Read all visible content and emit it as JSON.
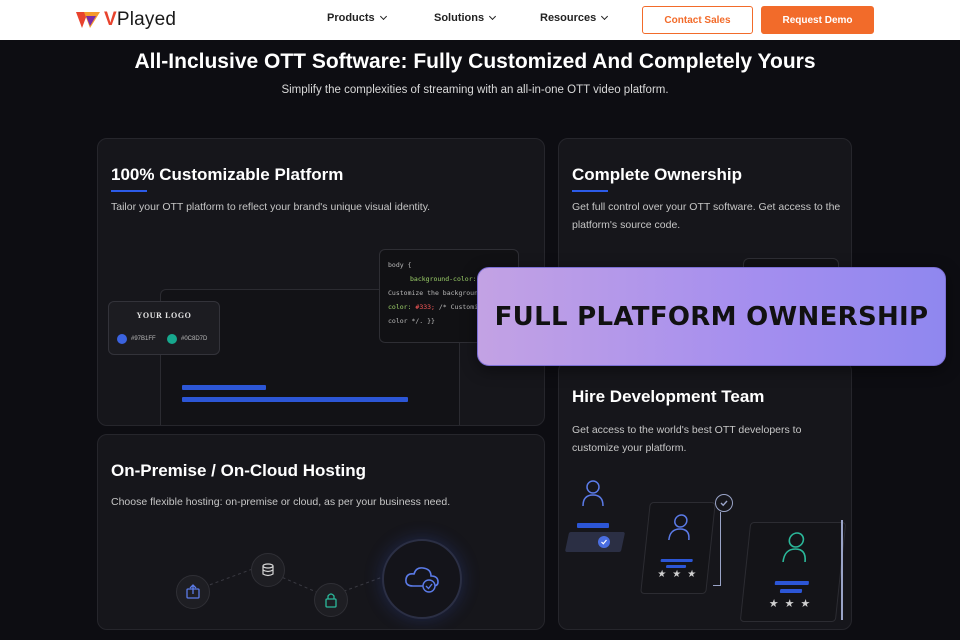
{
  "nav": {
    "logo_text_accent": "V",
    "logo_text_rest": "Played",
    "items": [
      {
        "label": "Products"
      },
      {
        "label": "Solutions"
      },
      {
        "label": "Resources"
      }
    ],
    "contact_label": "Contact Sales",
    "demo_label": "Request Demo"
  },
  "hero": {
    "title": "All-Inclusive OTT Software: Fully Customized And Completely Yours",
    "subtitle": "Simplify the complexities of streaming with an all-in-one OTT video platform."
  },
  "cards": {
    "customizable": {
      "title": "100% Customizable Platform",
      "desc": "Tailor your OTT platform to reflect your brand's unique visual identity.",
      "logo_label": "YOUR LOGO",
      "swatch1": "#97B1FF",
      "swatch2": "#0C8D7D",
      "code": {
        "line1": "body {",
        "line2a": "background-color: ",
        "line2b": "#",
        "line3": "Customize the background",
        "line4a": "color: ",
        "line4b": "#333;",
        "line4c": " /* Customize t",
        "line5": "color */.    }}"
      }
    },
    "ownership": {
      "title": "Complete Ownership",
      "desc": "Get full control over your OTT software. Get access to the platform's source code."
    },
    "hosting": {
      "title": "On-Premise / On-Cloud Hosting",
      "desc": "Choose flexible hosting: on-premise or cloud, as per your business need."
    },
    "devteam": {
      "title": "Hire Development Team",
      "desc": "Get access to the world's best OTT developers to customize your platform.",
      "stars": "★★★"
    }
  },
  "overlay": {
    "text": "FULL PLATFORM OWNERSHIP"
  },
  "colors": {
    "brand_orange": "#f26b2a",
    "accent_blue": "#2c5be8",
    "overlay_purple": "#a48eef"
  }
}
